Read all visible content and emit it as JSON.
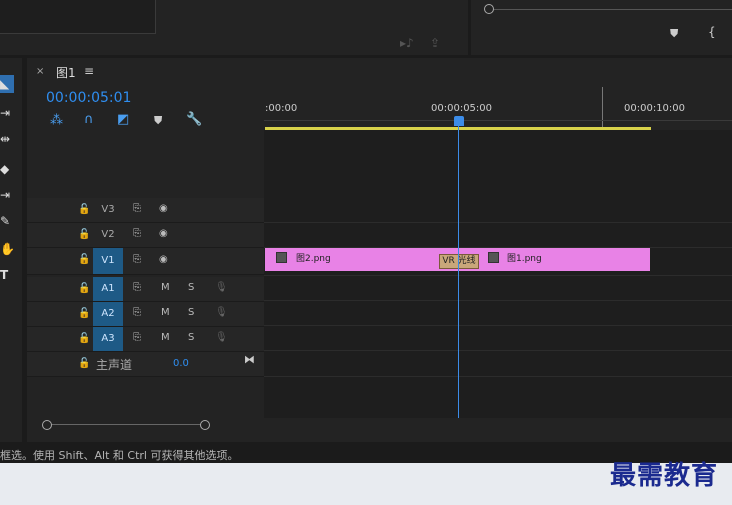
{
  "sequence": {
    "tab_close": "×",
    "tab_title": "图1",
    "tab_menu": "≡",
    "timecode": "00:00:05:01"
  },
  "ruler": {
    "labels": [
      ":00:00",
      "00:00:05:00",
      "00:00:10:00"
    ]
  },
  "tracks": {
    "video": [
      {
        "label": "V3",
        "active": false
      },
      {
        "label": "V2",
        "active": false
      },
      {
        "label": "V1",
        "active": true
      }
    ],
    "audio": [
      {
        "label": "A1",
        "mute": "M",
        "solo": "S"
      },
      {
        "label": "A2",
        "mute": "M",
        "solo": "S"
      },
      {
        "label": "A3",
        "mute": "M",
        "solo": "S"
      }
    ],
    "master": {
      "label": "主声道",
      "value": "0.0"
    }
  },
  "clips": [
    {
      "name": "图2.png"
    },
    {
      "name": "图1.png"
    }
  ],
  "transition": {
    "label": "VR 光线"
  },
  "status": {
    "text": "框选。使用 Shift、Alt 和 Ctrl 可获得其他选项。"
  },
  "watermark": "最需教育",
  "colors": {
    "accent": "#2f8ef0",
    "clip": "#e882e6",
    "work_area": "#d8d24a",
    "active_track": "#1e5a86"
  }
}
